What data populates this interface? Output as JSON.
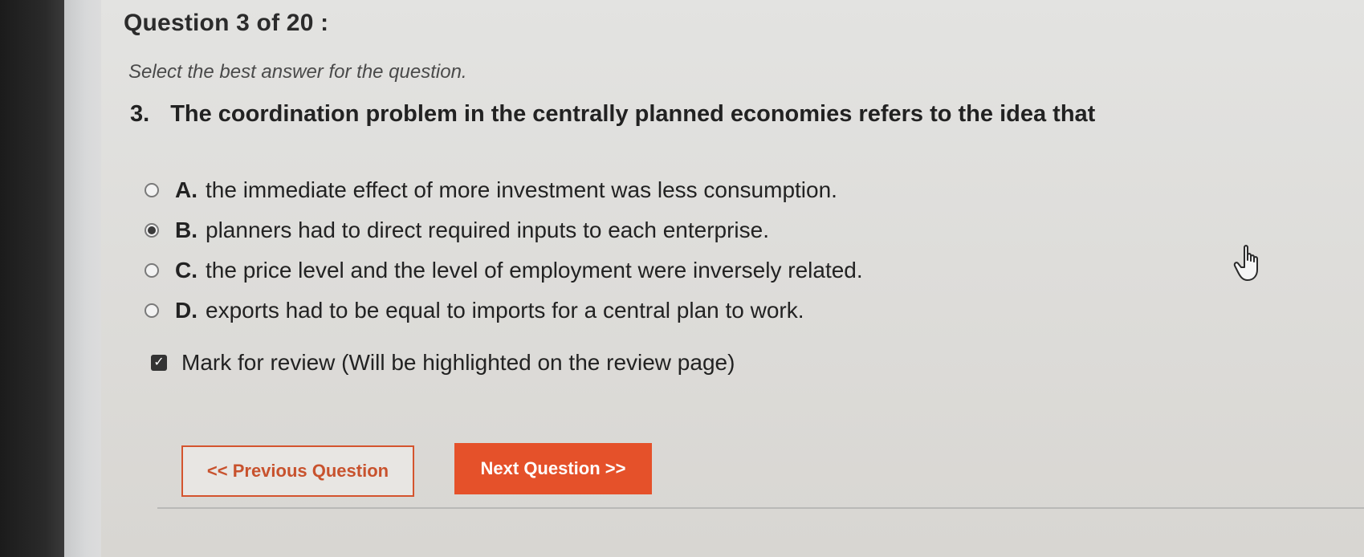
{
  "header": {
    "title": "Question 3 of 20 :"
  },
  "instructions": "Select the best answer for the question.",
  "question": {
    "number": "3.",
    "text": "The coordination problem in the centrally planned economies refers to the idea that"
  },
  "options": [
    {
      "letter": "A.",
      "text": "the immediate effect of more investment was less consumption.",
      "selected": false
    },
    {
      "letter": "B.",
      "text": "planners had to direct required inputs to each enterprise.",
      "selected": true
    },
    {
      "letter": "C.",
      "text": "the price level and the level of employment were inversely related.",
      "selected": false
    },
    {
      "letter": "D.",
      "text": "exports had to be equal to imports for a central plan to work.",
      "selected": false
    }
  ],
  "review": {
    "label": "Mark for review (Will be highlighted on the review page)",
    "checked": true
  },
  "buttons": {
    "previous": "<< Previous Question",
    "next": "Next Question >>"
  },
  "colors": {
    "accent": "#e5512a"
  },
  "icons": {
    "cursor": "hand-pointer-icon",
    "checkbox": "checkmark-icon"
  }
}
